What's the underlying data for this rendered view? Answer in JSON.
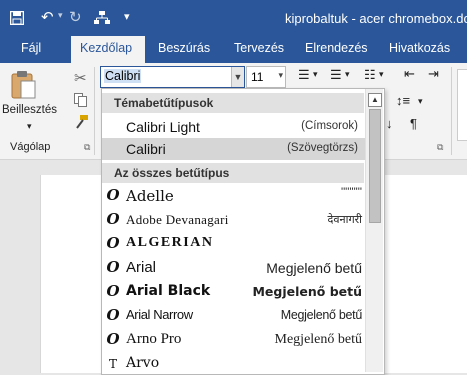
{
  "window": {
    "title": "kiprobaltuk - acer chromebox.doc"
  },
  "quick_access": {
    "save_icon": "save-icon",
    "undo_icon": "undo-icon",
    "redo_icon": "redo-icon",
    "customize": "▾"
  },
  "tabs": [
    {
      "label": "Fájl"
    },
    {
      "label": "Kezdőlap",
      "active": true
    },
    {
      "label": "Beszúrás"
    },
    {
      "label": "Tervezés"
    },
    {
      "label": "Elrendezés"
    },
    {
      "label": "Hivatkozás"
    }
  ],
  "ribbon": {
    "paste_label": "Beillesztés",
    "clipboard_group": "Vágólap",
    "font_name": "Calibri",
    "font_size": "11"
  },
  "dropdown": {
    "theme_header": "Témabetűtípusok",
    "theme_fonts": [
      {
        "name": "Calibri Light",
        "role": "(Címsorok)"
      },
      {
        "name": "Calibri",
        "role": "(Szövegtörzs)",
        "selected": true
      }
    ],
    "all_header": "Az összes betűtípus",
    "fonts": [
      {
        "name": "Adelle",
        "preview": "''''''''''",
        "icon": "O"
      },
      {
        "name": "Adobe Devanagari",
        "preview": "देवनागरी",
        "icon": "O"
      },
      {
        "name": "ALGERIAN",
        "preview": "",
        "icon": "O"
      },
      {
        "name": "Arial",
        "preview": "Megjelenő betű",
        "icon": "O"
      },
      {
        "name": "Arial Black",
        "preview": "Megjelenő betű",
        "icon": "O"
      },
      {
        "name": "Arial Narrow",
        "preview": "Megjelenő betű",
        "icon": "O"
      },
      {
        "name": "Arno Pro",
        "preview": "Megjelenő betű",
        "icon": "O"
      },
      {
        "name": "Arvo",
        "preview": "",
        "icon": "T"
      }
    ]
  },
  "colors": {
    "accent": "#2b579a",
    "ribbon": "#f3f3f3",
    "selected": "#d6d6d6"
  }
}
